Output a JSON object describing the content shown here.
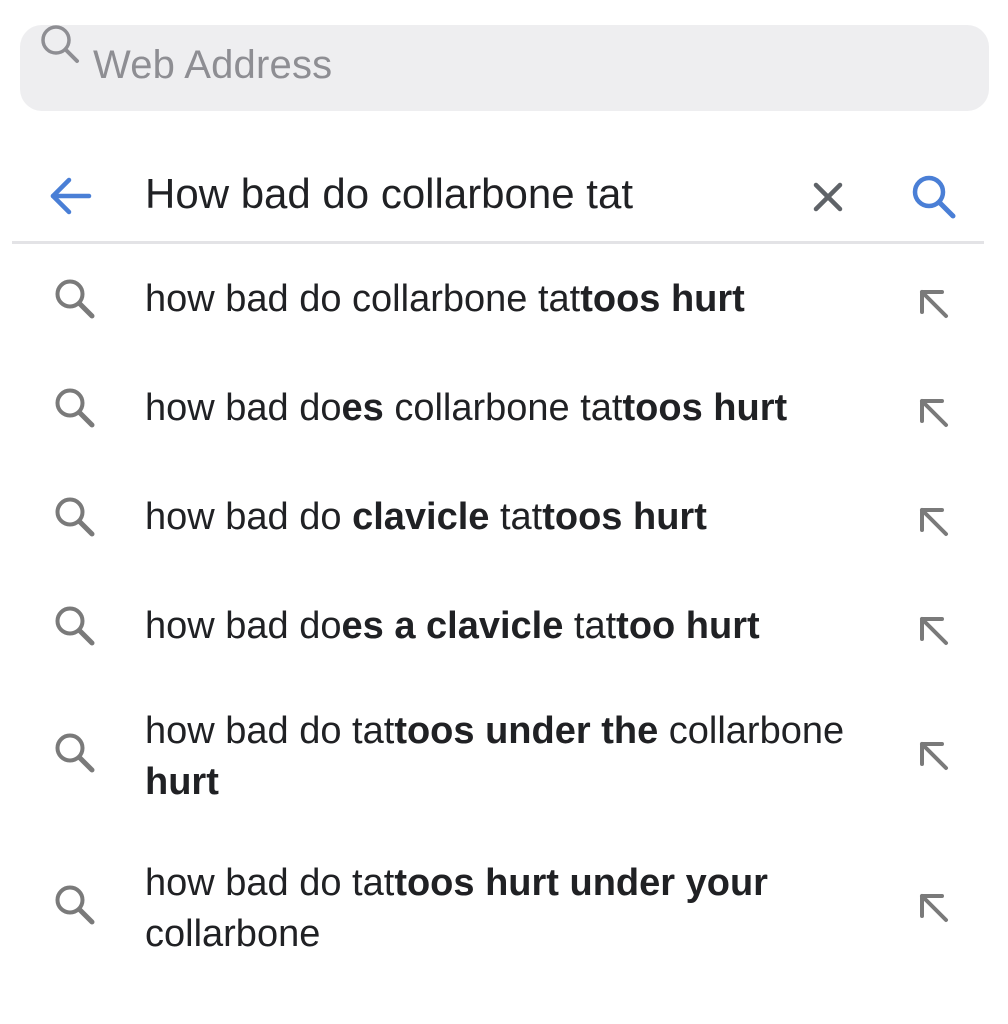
{
  "address_bar": {
    "placeholder": "Web Address",
    "icon": "search-icon"
  },
  "search": {
    "query": "How bad do collarbone tat",
    "back_icon": "back-arrow-icon",
    "clear_icon": "close-icon",
    "submit_icon": "search-icon"
  },
  "colors": {
    "accent": "#4a7fd6",
    "text": "#202124",
    "placeholder": "#8e8e93",
    "icon_gray": "#7a7a7a",
    "bar_background": "#eeeef0"
  },
  "suggestions": [
    {
      "parts": [
        {
          "text": "how bad do collarbone tat",
          "bold": false
        },
        {
          "text": "toos hurt",
          "bold": true
        }
      ]
    },
    {
      "parts": [
        {
          "text": "how bad do",
          "bold": false
        },
        {
          "text": "es",
          "bold": true
        },
        {
          "text": " collarbone tat",
          "bold": false
        },
        {
          "text": "toos hurt",
          "bold": true
        }
      ]
    },
    {
      "parts": [
        {
          "text": "how bad do ",
          "bold": false
        },
        {
          "text": "clavicle",
          "bold": true
        },
        {
          "text": " tat",
          "bold": false
        },
        {
          "text": "toos hurt",
          "bold": true
        }
      ]
    },
    {
      "parts": [
        {
          "text": "how bad do",
          "bold": false
        },
        {
          "text": "es a clavicle",
          "bold": true
        },
        {
          "text": " tat",
          "bold": false
        },
        {
          "text": "too hurt",
          "bold": true
        }
      ]
    },
    {
      "parts": [
        {
          "text": "how bad do tat",
          "bold": false
        },
        {
          "text": "toos under the",
          "bold": true
        },
        {
          "text": " collarbone ",
          "bold": false
        },
        {
          "text": "hurt",
          "bold": true
        }
      ]
    },
    {
      "parts": [
        {
          "text": "how bad do tat",
          "bold": false
        },
        {
          "text": "toos hurt under your",
          "bold": true
        },
        {
          "text": " collarbone",
          "bold": false
        }
      ]
    }
  ],
  "suggestion_icon": "search-icon",
  "fill_icon": "arrow-up-left-icon"
}
